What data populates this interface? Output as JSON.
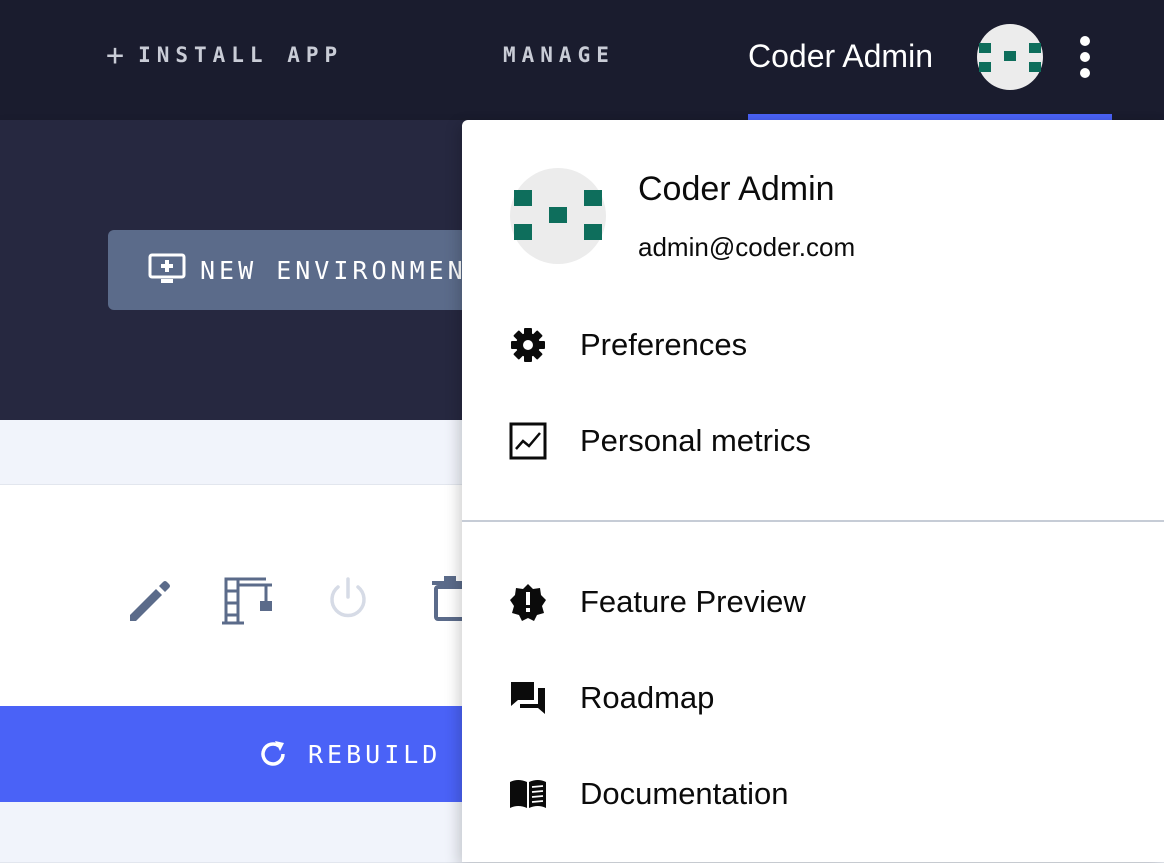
{
  "topbar": {
    "install_app": "INSTALL APP",
    "manage": "MANAGE",
    "user_name": "Coder Admin"
  },
  "hero": {
    "new_environment_label": "NEW ENVIRONMENT"
  },
  "environment_actions": {
    "icons": [
      "pencil-icon",
      "crane-icon",
      "power-icon",
      "trash-icon"
    ],
    "rebuild_label": "REBUILD NOW"
  },
  "user_menu": {
    "name": "Coder Admin",
    "email": "admin@coder.com",
    "items": [
      {
        "label": "Preferences",
        "icon": "gear-icon"
      },
      {
        "label": "Personal metrics",
        "icon": "chart-icon"
      },
      {
        "label": "Feature Preview",
        "icon": "badge-alert-icon"
      },
      {
        "label": "Roadmap",
        "icon": "forum-icon"
      },
      {
        "label": "Documentation",
        "icon": "book-icon"
      }
    ]
  },
  "colors": {
    "topbar_bg": "#1a1c2e",
    "hero_bg": "#262840",
    "accent": "#4a62f7",
    "avatar_green": "#0e6e5c",
    "button_slate": "#5b6b8a"
  }
}
